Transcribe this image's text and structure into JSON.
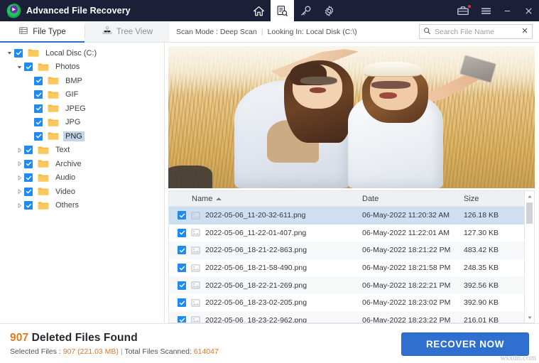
{
  "titlebar": {
    "app_title": "Advanced File Recovery",
    "logo_icon": "app-logo-icon",
    "nav_icons": [
      {
        "name": "home-icon",
        "active": false
      },
      {
        "name": "scan-search-icon",
        "active": true
      },
      {
        "name": "key-icon",
        "active": false
      },
      {
        "name": "gear-icon",
        "active": false
      }
    ],
    "window_icons": [
      {
        "name": "toolbox-icon",
        "badge": true
      },
      {
        "name": "hamburger-menu-icon",
        "badge": false
      },
      {
        "name": "minimize-icon",
        "badge": false
      },
      {
        "name": "close-icon",
        "badge": false
      }
    ]
  },
  "toolrow": {
    "tabs": [
      {
        "label": "File Type",
        "icon": "grid-list-icon",
        "active": true
      },
      {
        "label": "Tree View",
        "icon": "tree-hierarchy-icon",
        "active": false
      }
    ],
    "scan_mode_label": "Scan Mode : Deep Scan",
    "separator": "|",
    "looking_in_label": "Looking In: Local Disk (C:\\)",
    "search": {
      "placeholder": "Search File Name",
      "value": "",
      "icon": "search-icon",
      "clear_icon": "clear-x-icon"
    }
  },
  "sidebar": {
    "tree": [
      {
        "label": "Local Disc (C:)",
        "depth": 0,
        "twisty": "down",
        "checked": true,
        "selected": false
      },
      {
        "label": "Photos",
        "depth": 1,
        "twisty": "down",
        "checked": true,
        "selected": false
      },
      {
        "label": "BMP",
        "depth": 2,
        "twisty": "none",
        "checked": true,
        "selected": false
      },
      {
        "label": "GIF",
        "depth": 2,
        "twisty": "none",
        "checked": true,
        "selected": false
      },
      {
        "label": "JPEG",
        "depth": 2,
        "twisty": "none",
        "checked": true,
        "selected": false
      },
      {
        "label": "JPG",
        "depth": 2,
        "twisty": "none",
        "checked": true,
        "selected": false
      },
      {
        "label": "PNG",
        "depth": 2,
        "twisty": "none",
        "checked": true,
        "selected": true
      },
      {
        "label": "Text",
        "depth": 1,
        "twisty": "right",
        "checked": true,
        "selected": false
      },
      {
        "label": "Archive",
        "depth": 1,
        "twisty": "right",
        "checked": true,
        "selected": false
      },
      {
        "label": "Audio",
        "depth": 1,
        "twisty": "right",
        "checked": true,
        "selected": false
      },
      {
        "label": "Video",
        "depth": 1,
        "twisty": "right",
        "checked": true,
        "selected": false
      },
      {
        "label": "Others",
        "depth": 1,
        "twisty": "right",
        "checked": true,
        "selected": false
      }
    ]
  },
  "preview": {
    "description": "Photo preview of two women taking a selfie in a golden wheat field"
  },
  "filelist": {
    "columns": [
      "Name",
      "Date",
      "Size"
    ],
    "sort_column": "Name",
    "sort_direction": "ascending",
    "rows": [
      {
        "name": "2022-05-06_11-20-32-611.png",
        "date": "06-May-2022 11:20:32 AM",
        "size": "126.18 KB",
        "checked": true,
        "selected": true
      },
      {
        "name": "2022-05-06_11-22-01-407.png",
        "date": "06-May-2022 11:22:01 AM",
        "size": "127.30 KB",
        "checked": true,
        "selected": false
      },
      {
        "name": "2022-05-06_18-21-22-863.png",
        "date": "06-May-2022 18:21:22 PM",
        "size": "483.42 KB",
        "checked": true,
        "selected": false
      },
      {
        "name": "2022-05-06_18-21-58-490.png",
        "date": "06-May-2022 18:21:58 PM",
        "size": "248.35 KB",
        "checked": true,
        "selected": false
      },
      {
        "name": "2022-05-06_18-22-21-269.png",
        "date": "06-May-2022 18:22:21 PM",
        "size": "392.56 KB",
        "checked": true,
        "selected": false
      },
      {
        "name": "2022-05-06_18-23-02-205.png",
        "date": "06-May-2022 18:23:02 PM",
        "size": "392.90 KB",
        "checked": true,
        "selected": false
      },
      {
        "name": "2022-05-06_18-23-22-962.png",
        "date": "06-May-2022 18:23:22 PM",
        "size": "216.01 KB",
        "checked": true,
        "selected": false
      }
    ],
    "scrollbar": {
      "up_icon": "scroll-up-icon",
      "down_icon": "scroll-down-icon"
    }
  },
  "footer": {
    "found_count": "907",
    "found_label": "Deleted Files Found",
    "selected_prefix": "Selected Files : ",
    "selected_count": "907",
    "selected_size": "(221.03 MB)",
    "separator": " | ",
    "scanned_label": "Total Files Scanned: ",
    "scanned_count": "614047",
    "recover_button": "RECOVER NOW",
    "watermark": "wsxdn.com"
  },
  "colors": {
    "titlebar": "#1b2038",
    "accent_blue": "#2f6fd0",
    "checkbox_blue": "#1f8af0",
    "highlight_orange": "#e8761b",
    "row_selected": "#cfdff2",
    "tree_selected": "#c5d4e8"
  }
}
